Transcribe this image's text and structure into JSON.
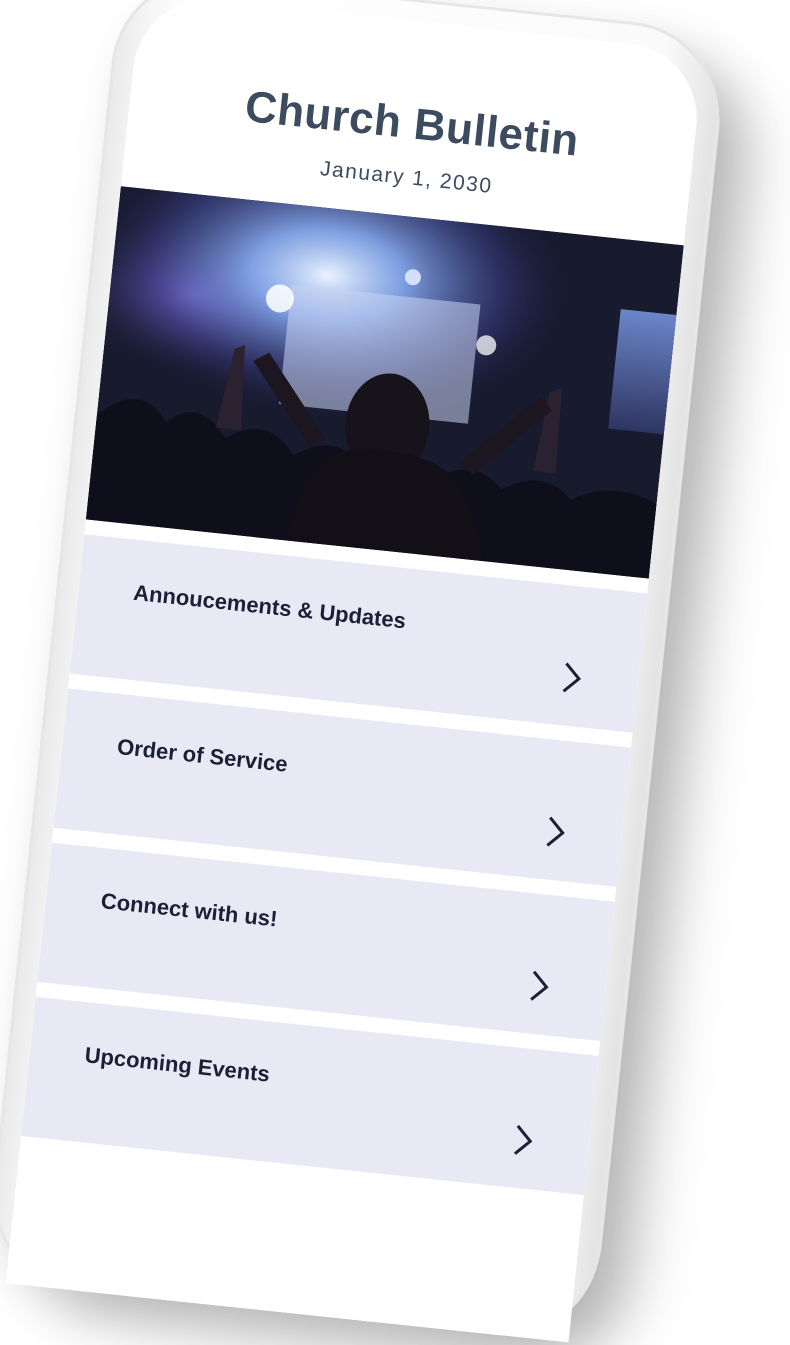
{
  "header": {
    "title": "Church Bulletin",
    "date": "January 1, 2030"
  },
  "hero": {
    "image_description_icon": "concert-worship-photo"
  },
  "menu": {
    "items": [
      {
        "label": "Annoucements & Updates"
      },
      {
        "label": "Order of Service"
      },
      {
        "label": "Connect with us!"
      },
      {
        "label": "Upcoming Events"
      }
    ]
  },
  "colors": {
    "title": "#3d4b5f",
    "menu_bg": "#e9e9f5",
    "menu_text": "#1b2036"
  }
}
